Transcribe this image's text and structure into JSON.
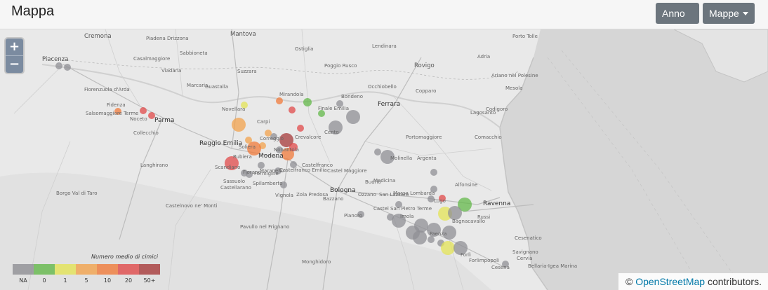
{
  "header": {
    "title": "Mappa",
    "anno_label": "Anno",
    "mappe_label": "Mappe"
  },
  "map": {
    "zoom_in": "+",
    "zoom_out": "−",
    "attribution": {
      "symbol": "©",
      "link_text": "OpenStreetMap",
      "suffix": "contributors."
    },
    "places": [
      {
        "name": "Mantova"
      },
      {
        "name": "Cremona"
      },
      {
        "name": "Piacenza"
      },
      {
        "name": "Parma"
      },
      {
        "name": "Reggio Emilia"
      },
      {
        "name": "Modena"
      },
      {
        "name": "Bologna"
      },
      {
        "name": "Ferrara"
      },
      {
        "name": "Rovigo"
      },
      {
        "name": "Ravenna"
      },
      {
        "name": "Carpi"
      },
      {
        "name": "Mirandola"
      },
      {
        "name": "Finale Emilia"
      },
      {
        "name": "Cento"
      },
      {
        "name": "Fidenza"
      },
      {
        "name": "Salsomaggiore Terme"
      },
      {
        "name": "Sassuolo"
      },
      {
        "name": "Lugo"
      },
      {
        "name": "Faenza"
      },
      {
        "name": "Forlì"
      },
      {
        "name": "Cesenatico"
      },
      {
        "name": "Comacchio"
      },
      {
        "name": "Argenta"
      },
      {
        "name": "Imola"
      },
      {
        "name": "Castelnovo ne' Monti"
      },
      {
        "name": "Pavullo nel Frignano"
      },
      {
        "name": "Vignola"
      },
      {
        "name": "Castel San Pietro Terme"
      },
      {
        "name": "Budrio"
      },
      {
        "name": "Molinella"
      },
      {
        "name": "Portomaggiore"
      },
      {
        "name": "Codigoro"
      },
      {
        "name": "Copparo"
      },
      {
        "name": "Adria"
      },
      {
        "name": "Lendinara"
      },
      {
        "name": "Guastalla"
      },
      {
        "name": "Casalmaggiore"
      },
      {
        "name": "Viadana"
      },
      {
        "name": "Suzzara"
      },
      {
        "name": "Ostiglia"
      },
      {
        "name": "Novellara"
      },
      {
        "name": "Correggio"
      },
      {
        "name": "Scandiano"
      },
      {
        "name": "Maranello"
      },
      {
        "name": "Castelfranco Emilia"
      },
      {
        "name": "Castel Maggiore"
      },
      {
        "name": "Collecchio"
      },
      {
        "name": "Noceto"
      },
      {
        "name": "Langhirano"
      },
      {
        "name": "Borgo Val di Taro"
      },
      {
        "name": "Fiorenzuola d'Arda"
      },
      {
        "name": "Castellarano"
      },
      {
        "name": "Spilamberto"
      },
      {
        "name": "Crevalcore"
      },
      {
        "name": "Alfonsine"
      },
      {
        "name": "Russi"
      },
      {
        "name": "Bondeno"
      },
      {
        "name": "Occhiobello"
      },
      {
        "name": "Sabbioneta"
      },
      {
        "name": "Piadena Drizzona"
      },
      {
        "name": "Marcaria"
      },
      {
        "name": "Poggio Rusco"
      },
      {
        "name": "Nonantola"
      },
      {
        "name": "Soliera"
      },
      {
        "name": "Rubiera"
      },
      {
        "name": "Formigine"
      },
      {
        "name": "Fiorano"
      },
      {
        "name": "Monghidoro"
      },
      {
        "name": "Bagnacavallo"
      },
      {
        "name": "Cervia"
      },
      {
        "name": "Cesena"
      },
      {
        "name": "Savignano"
      },
      {
        "name": "Bellaria-Igea Marina"
      },
      {
        "name": "Forlimpopoli"
      },
      {
        "name": "Lagosanto"
      },
      {
        "name": "Mesola"
      },
      {
        "name": "Ariano nel Polesine"
      },
      {
        "name": "Porto Tolle"
      },
      {
        "name": "Massa Lombarda"
      },
      {
        "name": "Castelfranco"
      },
      {
        "name": "Pianoro"
      },
      {
        "name": "Bazzano"
      },
      {
        "name": "Zola Predosa"
      },
      {
        "name": "San Lazzaro"
      },
      {
        "name": "Medicina"
      },
      {
        "name": "Ozzano"
      }
    ]
  },
  "legend": {
    "title": "Numero medio di cimici",
    "labels": [
      "NA",
      "0",
      "1",
      "5",
      "10",
      "20",
      "50+"
    ],
    "colors": [
      "#8f8f94",
      "#63b84a",
      "#e3e356",
      "#f2a24c",
      "#f07a3a",
      "#e04a4a",
      "#a63a3a"
    ]
  },
  "markers": [
    {
      "color": "#8f8f94",
      "level": "NA"
    },
    {
      "color": "#63b84a",
      "level": "0"
    },
    {
      "color": "#e3e356",
      "level": "1"
    },
    {
      "color": "#f2a24c",
      "level": "5"
    },
    {
      "color": "#f07a3a",
      "level": "10"
    },
    {
      "color": "#e04a4a",
      "level": "20"
    },
    {
      "color": "#a63a3a",
      "level": "50+"
    }
  ]
}
